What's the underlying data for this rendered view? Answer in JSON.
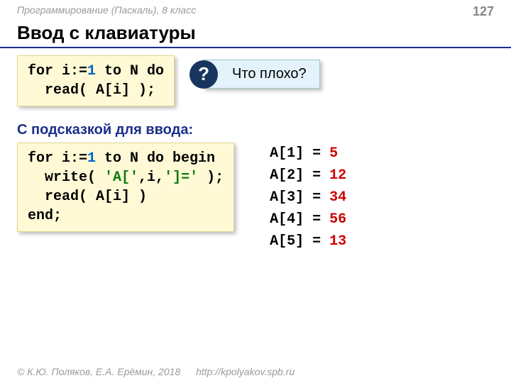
{
  "header": {
    "course": "Программирование (Паскаль), 8 класс",
    "page": "127"
  },
  "title": "Ввод с клавиатуры",
  "code1": {
    "l1a": "for i:=",
    "l1b": "1",
    "l1c": " to N do",
    "l2": "  read( A[i] );"
  },
  "callout": {
    "icon": "?",
    "text": "Что плохо?"
  },
  "subheading": "С подсказкой для ввода:",
  "code2": {
    "l1a": "for i:=",
    "l1b": "1",
    "l1c": " to N do begin",
    "l2a": "  write( ",
    "l2b": "'A['",
    "l2c": ",i,",
    "l2d": "']='",
    "l2e": " );",
    "l3": "  read( A[i] )",
    "l4": "end;"
  },
  "output": [
    {
      "label": "A[1] = ",
      "value": "5"
    },
    {
      "label": "A[2] = ",
      "value": "12"
    },
    {
      "label": "A[3] = ",
      "value": "34"
    },
    {
      "label": "A[4] = ",
      "value": "56"
    },
    {
      "label": "A[5] = ",
      "value": "13"
    }
  ],
  "footer": {
    "copyright": "© К.Ю. Поляков, Е.А. Ерёмин, 2018",
    "url": "http://kpolyakov.spb.ru"
  }
}
